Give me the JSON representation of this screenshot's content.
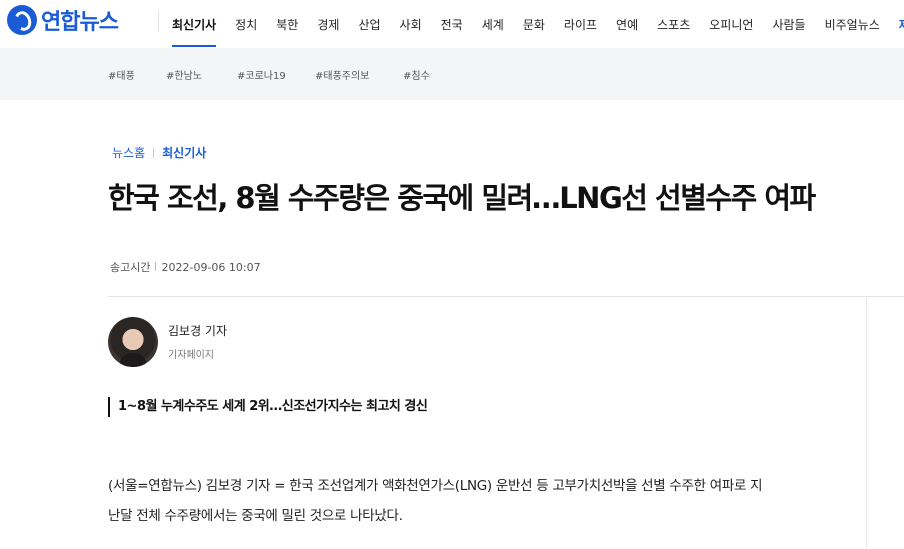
{
  "brand": {
    "logo_text": "연합뉴스",
    "logo_icon": "yonhap-logo-icon",
    "color": "#1a5cd6"
  },
  "nav": {
    "items": [
      {
        "label": "최신기사",
        "active": true
      },
      {
        "label": "정치"
      },
      {
        "label": "북한"
      },
      {
        "label": "경제"
      },
      {
        "label": "산업"
      },
      {
        "label": "사회"
      },
      {
        "label": "전국"
      },
      {
        "label": "세계"
      },
      {
        "label": "문화"
      },
      {
        "label": "라이프"
      },
      {
        "label": "연예"
      },
      {
        "label": "스포츠"
      },
      {
        "label": "오피니언"
      },
      {
        "label": "사람들"
      },
      {
        "label": "비주얼뉴스"
      },
      {
        "label": "제보"
      }
    ]
  },
  "hashtags": [
    "#태풍",
    "#한남노",
    "#코로나19",
    "#태풍주의보",
    "#침수"
  ],
  "breadcrumb": {
    "home": "뉴스홈",
    "current": "최신기사"
  },
  "article": {
    "title": "한국 조선, 8월 수주량은 중국에 밀려…LNG선 선별수주 여파",
    "meta_label": "송고시간",
    "meta_time": "2022-09-06 10:07",
    "reporter_name": "김보경 기자",
    "reporter_link": "기자페이지",
    "subhead": "1~8월 누계수주도 세계 2위…신조선가지수는 최고치 경신",
    "body_line1": "(서울=연합뉴스) 김보경 기자 = 한국 조선업계가 액화천연가스(LNG) 운반선 등 고부가치선박을 선별 수주한 여파로 지",
    "body_line2": "난달 전체 수주량에서는 중국에 밀린 것으로 나타났다."
  }
}
